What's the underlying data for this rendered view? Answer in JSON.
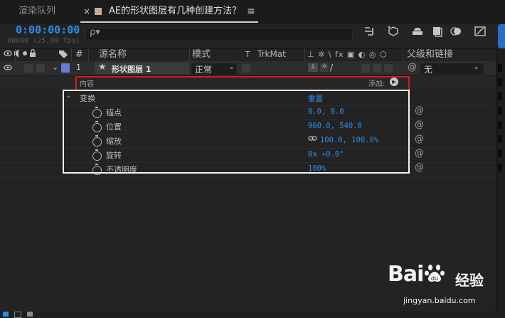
{
  "tabs": {
    "render_queue": "渲染队列",
    "close_glyph": "×",
    "comp": "AE的形状图层有几种创建方法？",
    "menu_glyph": "≡",
    "comp_swatch_color": "#c6ad8a"
  },
  "header": {
    "timecode": "0:00:00:00",
    "frame_info": "00000 (25.00 fps)",
    "search_glyph": "ρ▾"
  },
  "columns": {
    "number": "#",
    "source_name": "源名称",
    "mode": "模式",
    "t": "T",
    "trkmat": "TrkMat",
    "switches": "⊥ ✲ \\ fx ▣ ◐ ◎ ⬡",
    "parent": "父级和链接"
  },
  "layer": {
    "index": "1",
    "name": "形状图层 1",
    "mode": "正常",
    "parent_value": "无",
    "label_color": "#6b79d8"
  },
  "content": {
    "label": "内容",
    "add_label": "添加:",
    "add_glyph": "▶"
  },
  "transform": {
    "label": "变换",
    "reset": "重置",
    "properties": [
      {
        "name": "锚点",
        "value": "0.0, 0.0"
      },
      {
        "name": "位置",
        "value": "960.0, 540.0"
      },
      {
        "name": "缩放",
        "value": "100.0, 100.0%"
      },
      {
        "name": "旋转",
        "value": "0x +0.0°"
      },
      {
        "name": "不透明度",
        "value": "100%"
      }
    ]
  },
  "watermark": {
    "logo_left": "Bai",
    "logo_right": "经验",
    "url": "jingyan.baidu.com"
  },
  "colors": {
    "accent_blue": "#2d8ceb",
    "highlight_red": "#d21c1c"
  }
}
